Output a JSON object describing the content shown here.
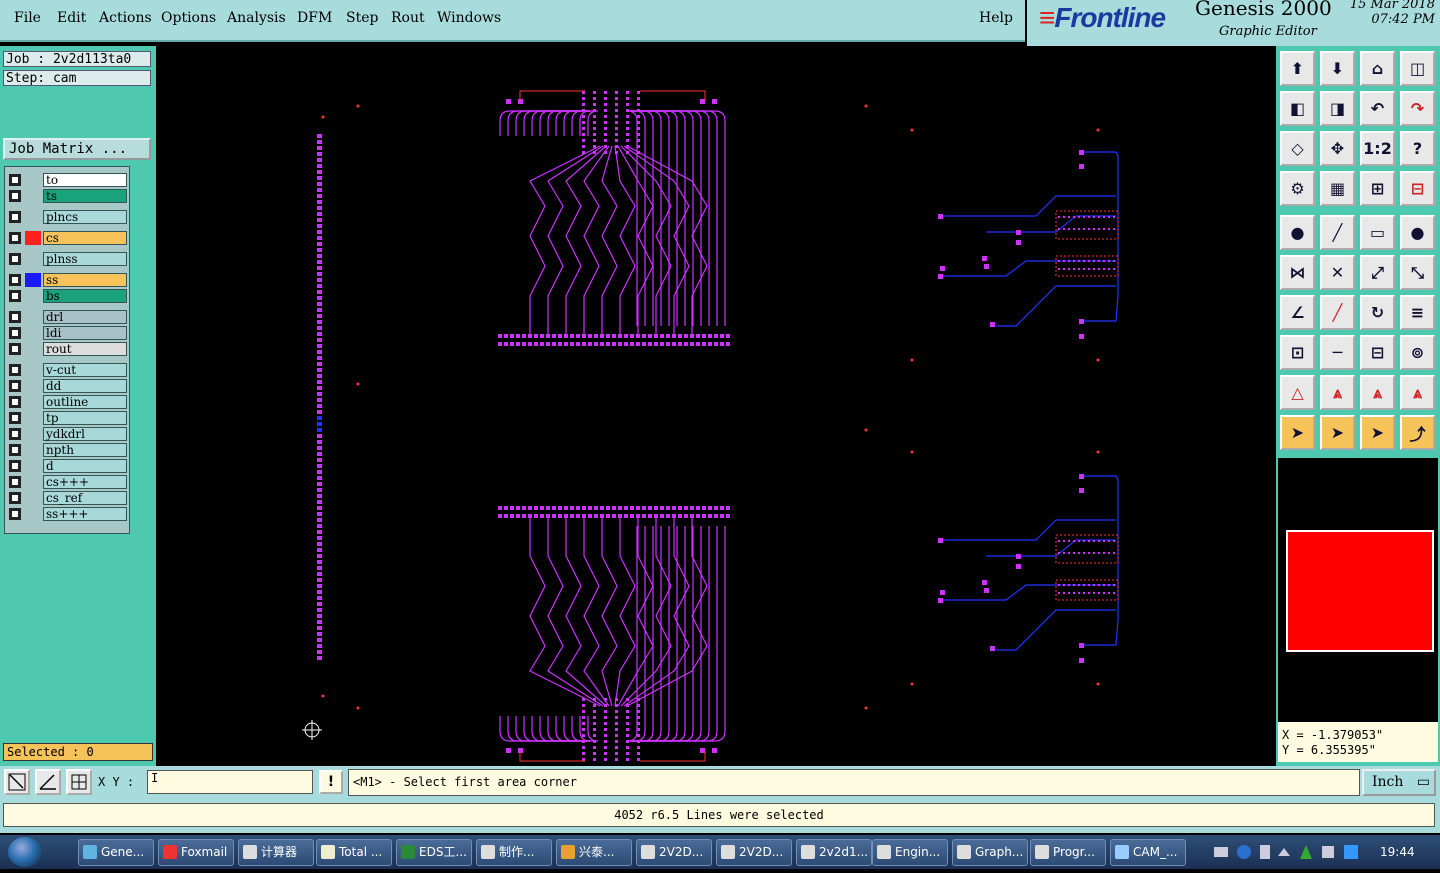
{
  "menus": [
    {
      "label": "File"
    },
    {
      "label": "Edit"
    },
    {
      "label": "Actions"
    },
    {
      "label": "Options"
    },
    {
      "label": "Analysis"
    },
    {
      "label": "DFM"
    },
    {
      "label": "Step"
    },
    {
      "label": "Rout"
    },
    {
      "label": "Windows"
    }
  ],
  "help_label": "Help",
  "brand": {
    "logo": "Frontline",
    "product": "Genesis 2000",
    "subtitle": "Graphic Editor",
    "date": "15 Mar 2018",
    "time": "07:42 PM"
  },
  "job": {
    "job_line": "Job : 2v2d113ta0",
    "step_line": "Step: cam",
    "job_matrix": "Job Matrix ..."
  },
  "layers": [
    {
      "name": "to",
      "color": "#ffffff",
      "swatch": ""
    },
    {
      "name": "ts",
      "color": "#1aa37a",
      "swatch": ""
    },
    {
      "name": "plncs",
      "color": "#a8d8d8",
      "swatch": ""
    },
    {
      "name": "cs",
      "color": "#f6c35a",
      "swatch": "#ff2020",
      "active": true
    },
    {
      "name": "plnss",
      "color": "#a8d8d8",
      "swatch": ""
    },
    {
      "name": "ss",
      "color": "#f6c35a",
      "swatch": "#1a1aff"
    },
    {
      "name": "bs",
      "color": "#1aa37a",
      "swatch": ""
    },
    {
      "name": "drl",
      "color": "#a8c0c8",
      "swatch": ""
    },
    {
      "name": "ldi",
      "color": "#a8c0c8",
      "swatch": ""
    },
    {
      "name": "rout",
      "color": "#dcdcdc",
      "swatch": ""
    },
    {
      "name": "v-cut",
      "color": "#a8d8d8",
      "swatch": ""
    },
    {
      "name": "dd",
      "color": "#a8d8d8",
      "swatch": ""
    },
    {
      "name": "outline",
      "color": "#a8d8d8",
      "swatch": ""
    },
    {
      "name": "tp",
      "color": "#a8d8d8",
      "swatch": ""
    },
    {
      "name": "ydkdrl",
      "color": "#a8d8d8",
      "swatch": ""
    },
    {
      "name": "npth",
      "color": "#a8d8d8",
      "swatch": ""
    },
    {
      "name": "d",
      "color": "#a8d8d8",
      "swatch": ""
    },
    {
      "name": "cs+++",
      "color": "#a8d8d8",
      "swatch": ""
    },
    {
      "name": "cs_ref",
      "color": "#a8d8d8",
      "swatch": ""
    },
    {
      "name": "ss+++",
      "color": "#a8d8d8",
      "swatch": ""
    }
  ],
  "selected_label": "Selected : 0",
  "coords": {
    "x": "X = -1.379053\"",
    "y": "Y = 6.355395\""
  },
  "bottom": {
    "xy_label": "X Y :",
    "xy_value": "I",
    "prompt": "<M1> - Select first area corner",
    "unit": "Inch"
  },
  "status_message": "4052 r6.5 Lines were selected",
  "toolbar_icons": [
    "open-icon",
    "save-icon",
    "home-icon",
    "window-icon",
    "back-icon",
    "forward-icon",
    "undo-icon",
    "redo-icon",
    "fit-icon",
    "zoom-icon",
    "ratio-icon",
    "help-icon",
    "settings-icon",
    "grid-icon",
    "snap-icon",
    "snap-red-icon",
    "pad-icon",
    "line-icon",
    "ruler-icon",
    "circle-icon",
    "connect-icon",
    "delete-icon",
    "move-icon",
    "copy-icon",
    "angle-icon",
    "draw-icon",
    "arc-icon",
    "text-icon",
    "resize-icon",
    "split-icon",
    "measure-icon",
    "group-icon",
    "route-a-icon",
    "route-b-icon",
    "route-c-icon",
    "route-d-icon",
    "select-icon",
    "select-box-icon",
    "select-circle-icon",
    "select-net-icon"
  ],
  "ratio_label": "1:2",
  "help_glyph": "?",
  "taskbar": [
    {
      "label": "Gene...",
      "color": "#5fb5e0"
    },
    {
      "label": "Foxmail",
      "color": "#e33"
    },
    {
      "label": "计算器",
      "color": "#ddd"
    },
    {
      "label": "Total ...",
      "color": "#eec"
    },
    {
      "label": "EDS工...",
      "color": "#2a8a3a"
    },
    {
      "label": "制作...",
      "color": "#ddd"
    },
    {
      "label": "兴泰...",
      "color": "#e8a030"
    },
    {
      "label": "2V2D...",
      "color": "#ddd"
    },
    {
      "label": "2V2D...",
      "color": "#ddd"
    },
    {
      "label": "2v2d1...",
      "color": "#ddd"
    },
    {
      "label": "Engin...",
      "color": "#ddd"
    },
    {
      "label": "Graph...",
      "color": "#ddd"
    },
    {
      "label": "Progr...",
      "color": "#ddd"
    },
    {
      "label": "CAM_...",
      "color": "#9cf"
    }
  ],
  "clock": "19:44"
}
